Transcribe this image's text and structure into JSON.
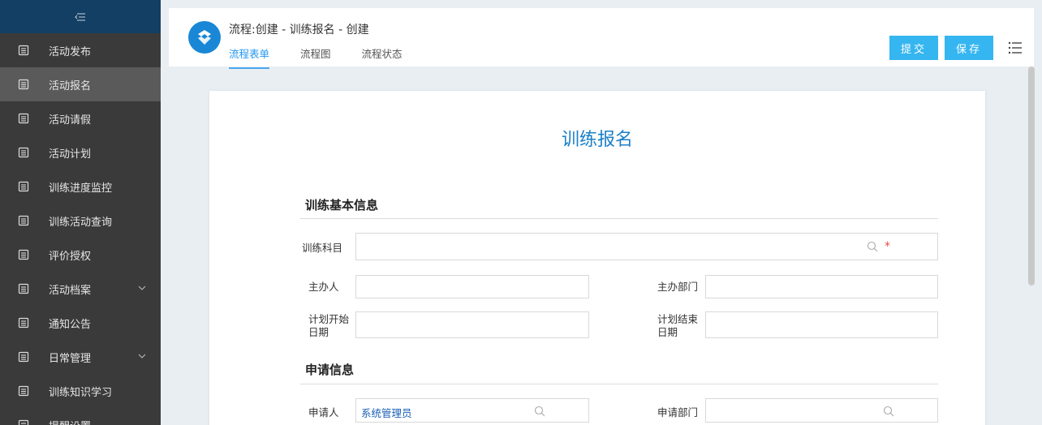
{
  "sidebar": {
    "items": [
      {
        "label": "活动发布"
      },
      {
        "label": "活动报名"
      },
      {
        "label": "活动请假"
      },
      {
        "label": "活动计划"
      },
      {
        "label": "训练进度监控"
      },
      {
        "label": "训练活动查询"
      },
      {
        "label": "评价授权"
      },
      {
        "label": "活动档案"
      },
      {
        "label": "通知公告"
      },
      {
        "label": "日常管理"
      },
      {
        "label": "训练知识学习"
      },
      {
        "label": "提醒设置"
      }
    ]
  },
  "header": {
    "title": "流程:创建 - 训练报名 - 创建",
    "tabs": [
      {
        "label": "流程表单"
      },
      {
        "label": "流程图"
      },
      {
        "label": "流程状态"
      }
    ],
    "submit_label": "提交",
    "save_label": "保存"
  },
  "form": {
    "title": "训练报名",
    "section1": {
      "title": "训练基本信息",
      "subject_label": "训练科目",
      "subject_value": "",
      "required_mark": "*",
      "organizer_label": "主办人",
      "organizer_value": "",
      "org_dept_label": "主办部门",
      "org_dept_value": "",
      "plan_start_label_1": "计划开始",
      "plan_start_label_2": "日期",
      "plan_start_value": "",
      "plan_end_label_1": "计划结束",
      "plan_end_label_2": "日期",
      "plan_end_value": ""
    },
    "section2": {
      "title": "申请信息",
      "applicant_label": "申请人",
      "applicant_value": "系统管理员",
      "applicant_dept_label": "申请部门",
      "applicant_dept_value": ""
    }
  }
}
